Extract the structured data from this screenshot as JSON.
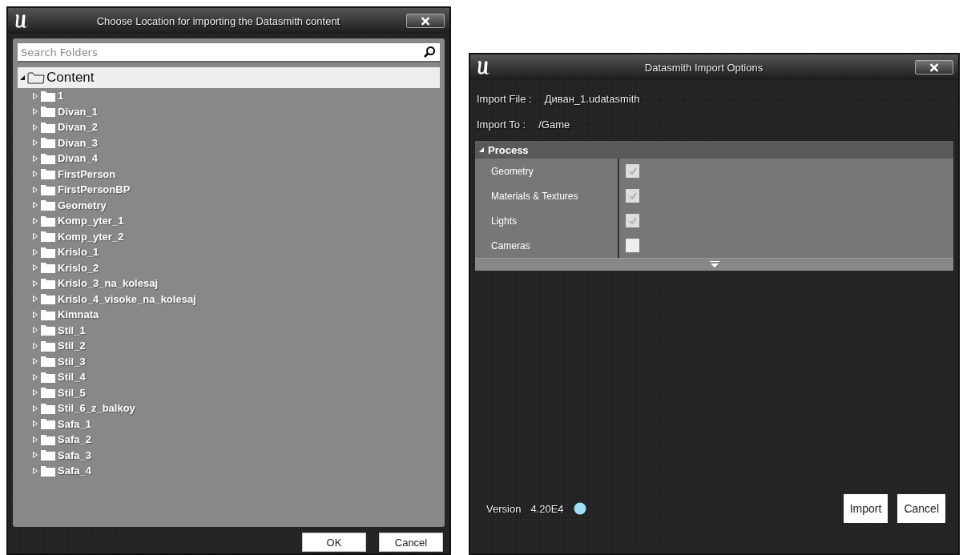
{
  "location_dialog": {
    "title": "Choose Location for importing the Datasmith content",
    "search": {
      "placeholder": "Search Folders"
    },
    "tree": {
      "label": "Content",
      "expanded": true,
      "selected": true,
      "children": [
        {
          "label": "1",
          "expanded": false
        },
        {
          "label": "Divan_1",
          "expanded": false
        },
        {
          "label": "Divan_2",
          "expanded": false
        },
        {
          "label": "Divan_3",
          "expanded": false
        },
        {
          "label": "Divan_4",
          "expanded": false
        },
        {
          "label": "FirstPerson",
          "expanded": false
        },
        {
          "label": "FirstPersonBP",
          "expanded": false
        },
        {
          "label": "Geometry",
          "expanded": false
        },
        {
          "label": "Komp_yter_1",
          "expanded": false
        },
        {
          "label": "Komp_yter_2",
          "expanded": false
        },
        {
          "label": "Krislo_1",
          "expanded": false
        },
        {
          "label": "Krislo_2",
          "expanded": false
        },
        {
          "label": "Krislo_3_na_kolesaj",
          "expanded": false
        },
        {
          "label": "Krislo_4_visoke_na_kolesaj",
          "expanded": false
        },
        {
          "label": "Kimnata",
          "expanded": false
        },
        {
          "label": "Stil_1",
          "expanded": false
        },
        {
          "label": "Stil_2",
          "expanded": false
        },
        {
          "label": "Stil_3",
          "expanded": false
        },
        {
          "label": "Stil_4",
          "expanded": false
        },
        {
          "label": "Stil_5",
          "expanded": false
        },
        {
          "label": "Stil_6_z_balkoy",
          "expanded": false
        },
        {
          "label": "Safa_1",
          "expanded": false
        },
        {
          "label": "Safa_2",
          "expanded": false
        },
        {
          "label": "Safa_3",
          "expanded": false
        },
        {
          "label": "Safa_4",
          "expanded": false
        }
      ]
    },
    "buttons": [
      "OK",
      "Cancel"
    ]
  },
  "options_dialog": {
    "title": "Datasmith Import Options",
    "fields": [
      {
        "label": "Import File :",
        "value": "Диван_1.udatasmith"
      },
      {
        "label": "Import To  :",
        "value": "/Game"
      }
    ],
    "section": {
      "title": "Process",
      "expanded": true,
      "options": [
        {
          "label": "Geometry",
          "checked": true
        },
        {
          "label": "Materials & Textures",
          "checked": true
        },
        {
          "label": "Lights",
          "checked": true
        },
        {
          "label": "Cameras",
          "checked": false
        }
      ]
    },
    "version_label": "Version",
    "version": "4.20E4",
    "buttons": [
      "Import",
      "Cancel"
    ]
  }
}
